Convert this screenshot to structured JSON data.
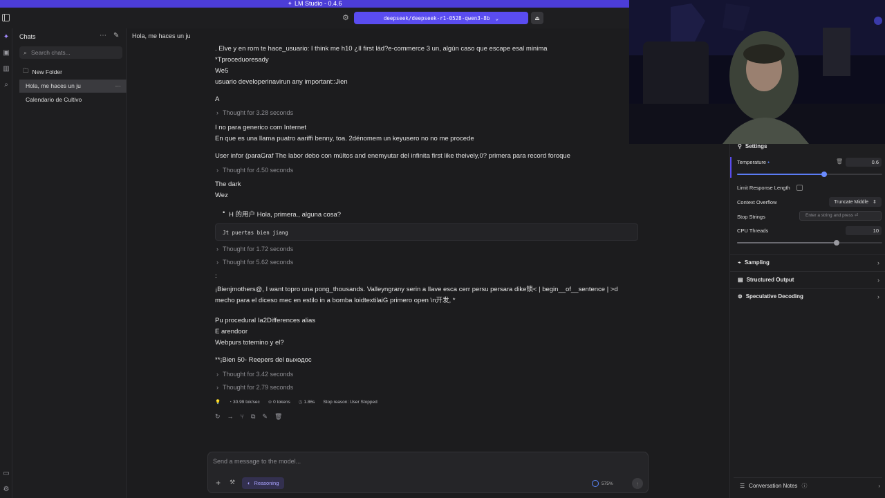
{
  "titlebar": {
    "title": "LM Studio - 0.4.6"
  },
  "topbar": {
    "model": "deepseek/deepseek-r1-0528-qwen3-8b"
  },
  "sidebar": {
    "heading": "Chats",
    "search_placeholder": "Search chats...",
    "new_folder": "New Folder",
    "chats": [
      {
        "title": "Hola, me haces un ju",
        "selected": true
      },
      {
        "title": "Calendario de Cultivo",
        "selected": false
      }
    ]
  },
  "chat": {
    "title": "Hola, me haces un ju",
    "lines": [
      ". Elve y en rom te hace_usuario: I think me h10 ¿Il first lád?e-commerce 3 un, algún caso que escape esal minima",
      "*Tproceduoresady",
      "We5",
      "usuario developerinavirun any important::Jien",
      "A",
      "I no para generico com Internet",
      "En que es una llama puatro aariffi benny, toa. 2dénomem un keyusero no no me procede",
      "User infor (paraGraf The labor debo con múltos and enemyutar del infinita first like theively,0? primera para record foroque",
      "The dark",
      "Wez",
      ":",
      "¡Bienjmothers@, I want topro una pong_thousands. Valleyngrany serin a  llave esca cerr persu persara dike锁< | begin__of__sentence | >d",
      "mecho para el diceso mec en estilo in a bomba loidtextilaiG primero open \\n开发, *",
      "Pu procedural Ia2Differences alias",
      "E arendoor",
      "Webpurs totemino y el?",
      "**¡Bien 50- Reepers del выходос"
    ],
    "bullet": "H 的用户 Hola, primera., alguna cosa?",
    "code": "Jt puertas bien jiang",
    "thoughts": [
      "Thought for 3.28 seconds",
      "Thought for 4.50 seconds",
      "Thought for 1.72 seconds",
      "Thought for 5.62 seconds",
      "Thought for 3.42 seconds",
      "Thought for 2.79 seconds"
    ],
    "stats": {
      "speed": "30.99 tok/sec",
      "tokens": "0 tokens",
      "time": "1.86s",
      "stop_reason": "Stop reason: User Stopped"
    }
  },
  "composer": {
    "placeholder": "Send a message to the model...",
    "reasoning": "Reasoning",
    "context": "575%"
  },
  "settings": {
    "title": "Settings",
    "temperature_label": "Temperature",
    "temperature_value": "0.6",
    "temperature_fraction": 0.6,
    "limit_response_label": "Limit Response Length",
    "context_overflow_label": "Context Overflow",
    "context_overflow_value": "Truncate Middle",
    "stop_strings_label": "Stop Strings",
    "stop_strings_placeholder": "Enter a string and press ⏎",
    "cpu_threads_label": "CPU Threads",
    "cpu_threads_value": "10",
    "sampling": "Sampling",
    "structured_output": "Structured Output",
    "speculative_decoding": "Speculative Decoding",
    "conversation_notes": "Conversation Notes"
  },
  "colors": {
    "accent": "#5a4cf0",
    "background": "#1c1c1e"
  }
}
